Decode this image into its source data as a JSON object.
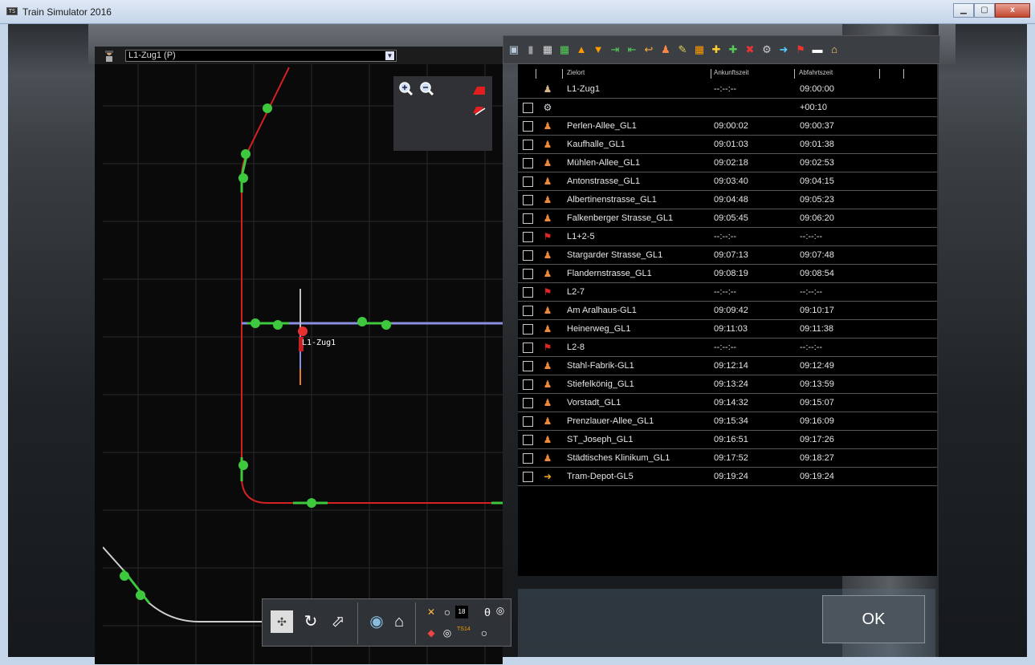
{
  "window": {
    "title": "Train Simulator 2016",
    "app_icon_text": "TS",
    "minimize": "▁",
    "maximize": "▢",
    "close": "x"
  },
  "map": {
    "train_select": "L1-Zug1 (P)",
    "train_label": "L1-Zug1",
    "zoom_in_icon": "zoom-in",
    "zoom_out_icon": "zoom-out"
  },
  "toolbar_icons": [
    "save-icon",
    "delete-icon",
    "grid-icon",
    "grid-green-icon",
    "move-up-icon",
    "move-down-icon",
    "insert-before-icon",
    "insert-after-icon",
    "reverse-icon",
    "passenger-icon",
    "edit-icon",
    "grid-orange-icon",
    "add-green-icon",
    "add-yellow-icon",
    "remove-icon",
    "settings-icon",
    "arrival-icon",
    "flag-icon",
    "bar-icon",
    "bridge-icon"
  ],
  "timetable": {
    "columns": {
      "destination": "Zielort",
      "arrival": "Ankunftszeit",
      "departure": "Abfahrtszeit"
    },
    "rows": [
      {
        "icon": "driver",
        "dest": "L1-Zug1",
        "arr": "--:--:--",
        "dep": "09:00:00",
        "cb": false
      },
      {
        "icon": "settings",
        "dest": "",
        "arr": "",
        "dep": "+00:10",
        "cb": true
      },
      {
        "icon": "passenger",
        "dest": "Perlen-Allee_GL1",
        "arr": "09:00:02",
        "dep": "09:00:37",
        "cb": true
      },
      {
        "icon": "passenger",
        "dest": "Kaufhalle_GL1",
        "arr": "09:01:03",
        "dep": "09:01:38",
        "cb": true
      },
      {
        "icon": "passenger",
        "dest": "Mühlen-Allee_GL1",
        "arr": "09:02:18",
        "dep": "09:02:53",
        "cb": true
      },
      {
        "icon": "passenger",
        "dest": "Antonstrasse_GL1",
        "arr": "09:03:40",
        "dep": "09:04:15",
        "cb": true
      },
      {
        "icon": "passenger",
        "dest": "Albertinenstrasse_GL1",
        "arr": "09:04:48",
        "dep": "09:05:23",
        "cb": true
      },
      {
        "icon": "passenger",
        "dest": "Falkenberger Strasse_GL1",
        "arr": "09:05:45",
        "dep": "09:06:20",
        "cb": true
      },
      {
        "icon": "flag",
        "dest": "L1+2-5",
        "arr": "--:--:--",
        "dep": "--:--:--",
        "cb": true
      },
      {
        "icon": "passenger",
        "dest": "Stargarder Strasse_GL1",
        "arr": "09:07:13",
        "dep": "09:07:48",
        "cb": true
      },
      {
        "icon": "passenger",
        "dest": "Flandernstrasse_GL1",
        "arr": "09:08:19",
        "dep": "09:08:54",
        "cb": true
      },
      {
        "icon": "flag",
        "dest": "L2-7",
        "arr": "--:--:--",
        "dep": "--:--:--",
        "cb": true
      },
      {
        "icon": "passenger",
        "dest": "Am Aralhaus-GL1",
        "arr": "09:09:42",
        "dep": "09:10:17",
        "cb": true
      },
      {
        "icon": "passenger",
        "dest": "Heinerweg_GL1",
        "arr": "09:11:03",
        "dep": "09:11:38",
        "cb": true
      },
      {
        "icon": "flag",
        "dest": "L2-8",
        "arr": "--:--:--",
        "dep": "--:--:--",
        "cb": true
      },
      {
        "icon": "passenger",
        "dest": "Stahl-Fabrik-GL1",
        "arr": "09:12:14",
        "dep": "09:12:49",
        "cb": true
      },
      {
        "icon": "passenger",
        "dest": "Stiefelkönig_GL1",
        "arr": "09:13:24",
        "dep": "09:13:59",
        "cb": true
      },
      {
        "icon": "passenger",
        "dest": "Vorstadt_GL1",
        "arr": "09:14:32",
        "dep": "09:15:07",
        "cb": true
      },
      {
        "icon": "passenger",
        "dest": "Prenzlauer-Allee_GL1",
        "arr": "09:15:34",
        "dep": "09:16:09",
        "cb": true
      },
      {
        "icon": "passenger",
        "dest": "ST_Joseph_GL1",
        "arr": "09:16:51",
        "dep": "09:17:26",
        "cb": true
      },
      {
        "icon": "passenger",
        "dest": "Städtisches Klinikum_GL1",
        "arr": "09:17:52",
        "dep": "09:18:27",
        "cb": true
      },
      {
        "icon": "arrival",
        "dest": "Tram-Depot-GL5",
        "arr": "09:19:24",
        "dep": "09:19:24",
        "cb": true
      }
    ]
  },
  "ok_label": "OK",
  "bottom_bar": {
    "speed_value": "18",
    "track_label": "TS14"
  },
  "colors": {
    "track_red": "#d42020",
    "track_green": "#3ec83e",
    "track_blue": "#8a8fe0",
    "track_grey": "#cfcfcf",
    "node": "#3ec83e",
    "grid": "#2a2a2a"
  }
}
